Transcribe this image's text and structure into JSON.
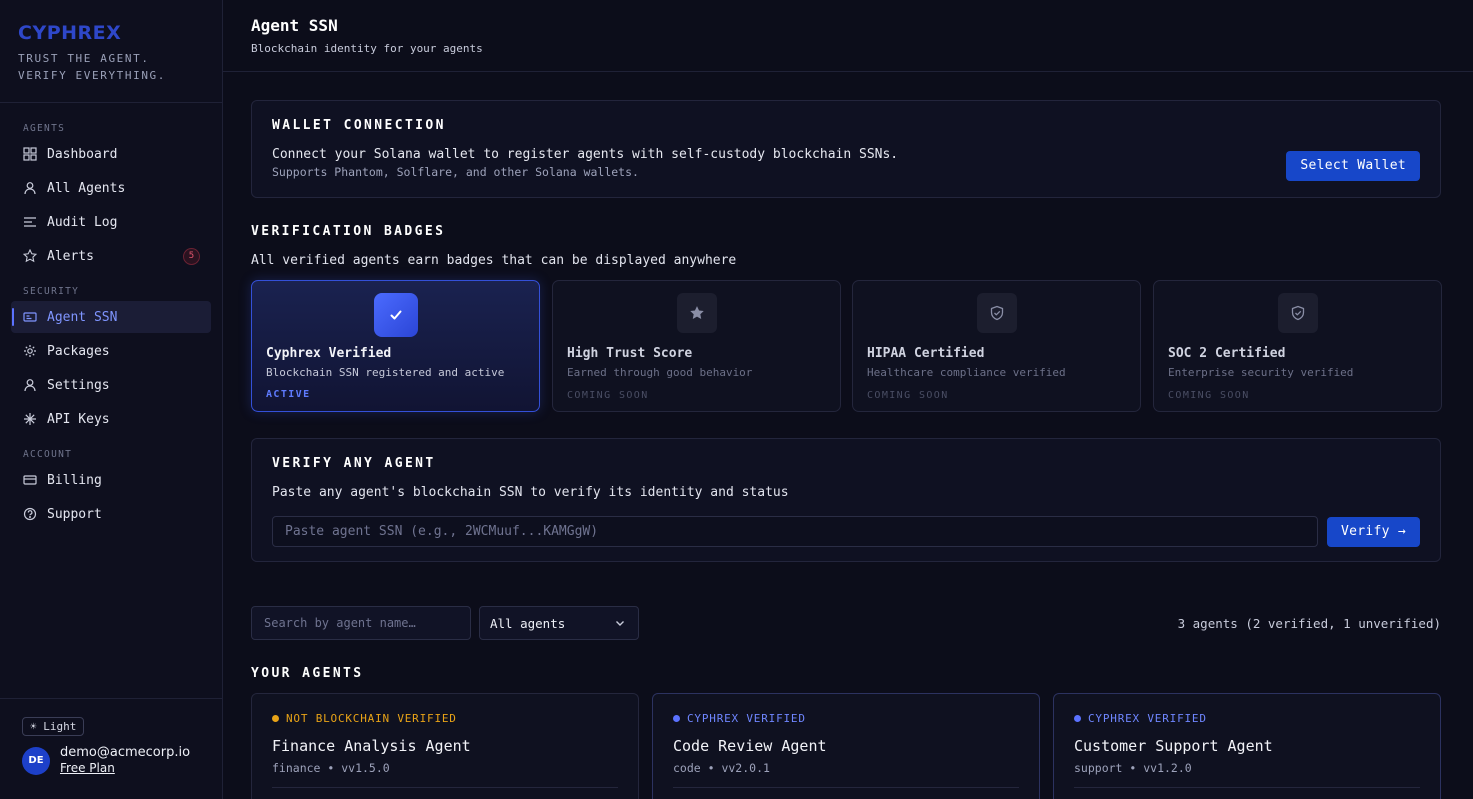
{
  "brand": {
    "logo": "CYPHREX",
    "tagline_1": "TRUST THE AGENT.",
    "tagline_2": "VERIFY EVERYTHING.",
    "accent_color": "#2e47c9"
  },
  "sidebar": {
    "sections": {
      "agents": "AGENTS",
      "security": "SECURITY",
      "account": "ACCOUNT"
    },
    "items": [
      {
        "label": "Dashboard",
        "icon": "grid-icon"
      },
      {
        "label": "All Agents",
        "icon": "user-icon"
      },
      {
        "label": "Audit Log",
        "icon": "list-icon"
      },
      {
        "label": "Alerts",
        "icon": "star-icon",
        "count": "5"
      },
      {
        "label": "Agent SSN",
        "icon": "id-card-icon",
        "active": true
      },
      {
        "label": "Packages",
        "icon": "gear-icon"
      },
      {
        "label": "Settings",
        "icon": "user-icon"
      },
      {
        "label": "API Keys",
        "icon": "asterisk-icon"
      },
      {
        "label": "Billing",
        "icon": "credit-card-icon"
      },
      {
        "label": "Support",
        "icon": "help-icon"
      }
    ],
    "theme_toggle": "☀ Light",
    "user": {
      "initials": "DE",
      "email": "demo@acmecorp.io",
      "plan": "Free Plan"
    }
  },
  "header": {
    "title": "Agent SSN",
    "subtitle": "Blockchain identity for your agents"
  },
  "wallet": {
    "title": "WALLET CONNECTION",
    "line1": "Connect your Solana wallet to register agents with self-custody blockchain SSNs.",
    "line2": "Supports Phantom, Solflare, and other Solana wallets.",
    "button": "Select Wallet"
  },
  "badges": {
    "title": "VERIFICATION BADGES",
    "description": "All verified agents earn badges that can be displayed anywhere",
    "items": [
      {
        "name": "Cyphrex Verified",
        "desc": "Blockchain SSN registered and active",
        "status": "ACTIVE",
        "icon": "check-icon"
      },
      {
        "name": "High Trust Score",
        "desc": "Earned through good behavior",
        "status": "COMING SOON",
        "icon": "star-icon"
      },
      {
        "name": "HIPAA Certified",
        "desc": "Healthcare compliance verified",
        "status": "COMING SOON",
        "icon": "shield-icon"
      },
      {
        "name": "SOC 2 Certified",
        "desc": "Enterprise security verified",
        "status": "COMING SOON",
        "icon": "shield-icon"
      }
    ]
  },
  "verify": {
    "title": "VERIFY ANY AGENT",
    "description": "Paste any agent's blockchain SSN to verify its identity and status",
    "placeholder": "Paste agent SSN (e.g., 2WCMuuf...KAMGgW)",
    "button": "Verify →"
  },
  "filters": {
    "search_placeholder": "Search by agent name…",
    "select_value": "All agents",
    "counts": "3 agents (2 verified, 1 unverified)"
  },
  "agents": {
    "title": "YOUR AGENTS",
    "items": [
      {
        "status": "NOT BLOCKCHAIN VERIFIED",
        "status_color": "#e8a317",
        "name": "Finance Analysis Agent",
        "meta": "finance • vv1.5.0"
      },
      {
        "status": "CYPHREX VERIFIED",
        "status_color": "#5b72ff",
        "name": "Code Review Agent",
        "meta": "code • vv2.0.1"
      },
      {
        "status": "CYPHREX VERIFIED",
        "status_color": "#5b72ff",
        "name": "Customer Support Agent",
        "meta": "support • vv1.2.0"
      }
    ]
  }
}
